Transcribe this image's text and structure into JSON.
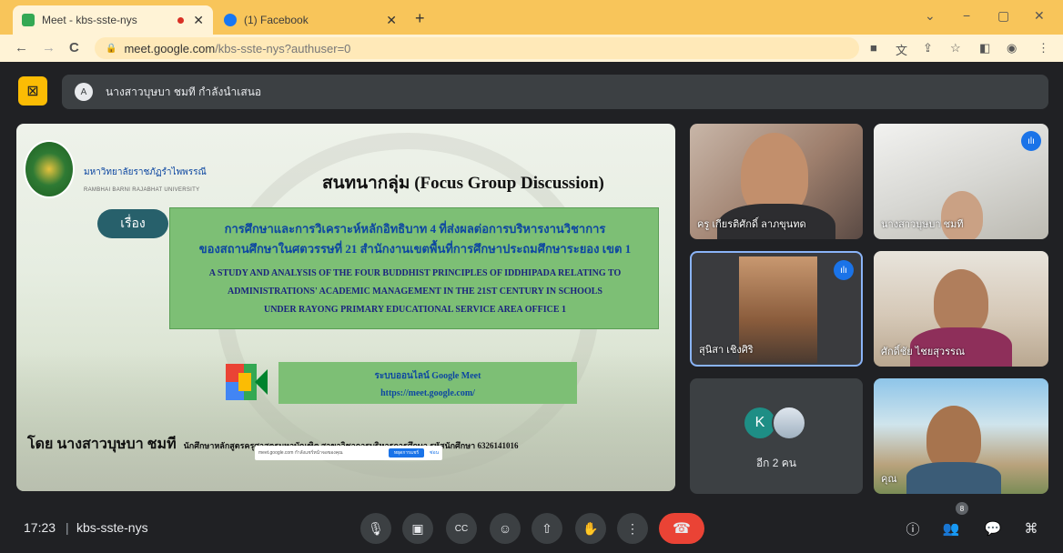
{
  "browser": {
    "tabs": [
      {
        "title": "Meet - kbs-sste-nys",
        "active": true
      },
      {
        "title": "(1) Facebook",
        "active": false
      }
    ],
    "new_tab": "+",
    "window": {
      "minimize": "−",
      "restore": "▢",
      "close": "✕",
      "chevron": "⌄"
    },
    "url": {
      "host": "meet.google.com",
      "path": "/kbs-sste-nys?authuser=0"
    },
    "nav": {
      "back": "←",
      "forward": "→",
      "reload": "C"
    }
  },
  "meet": {
    "presenting_text": "นางสาวบุษบา ชมที กำลังนำเสนอ",
    "presenter_initial": "A",
    "meeting_time": "17:23",
    "separator": "|",
    "meeting_code": "kbs-sste-nys",
    "participants_badge": "8",
    "others_label": "อีก 2 คน",
    "others_initial": "K"
  },
  "slide": {
    "university_th": "มหาวิทยาลัยราชภัฏรำไพพรรณี",
    "university_en": "RAMBHAI BARNI RAJABHAT UNIVERSITY",
    "title": "สนทนากลุ่ม (Focus Group Discussion)",
    "subject_label": "เรื่อง",
    "thai_line1": "การศึกษาและการวิเคราะห์หลักอิทธิบาท 4 ที่ส่งผลต่อการบริหารงานวิชาการ",
    "thai_line2": "ของสถานศึกษาในศตวรรษที่ 21 สำนักงานเขตพื้นที่การศึกษาประถมศึกษาระยอง เขต 1",
    "en_line1": "A STUDY AND ANALYSIS OF THE FOUR BUDDHIST PRINCIPLES OF IDDHIPADA RELATING TO",
    "en_line2": "ADMINISTRATIONS' ACADEMIC MANAGEMENT IN THE 21ST CENTURY IN SCHOOLS",
    "en_line3": "UNDER RAYONG PRIMARY EDUCATIONAL SERVICE AREA OFFICE 1",
    "online_label": "ระบบออนไลน์ Google Meet",
    "online_url": "https://meet.google.com/",
    "by_line": "โดย นางสาวบุษบา ชมที",
    "by_details": "นักศึกษาหลักสูตรครุศาสตรมหาบัณฑิต   สาขาวิชาการบริหารการศึกษา   รหัสนักศึกษา 6326141016",
    "share_banner_text": "meet.google.com กำลังแชร์หน้าจอของคุณ",
    "share_stop": "หยุดการแชร์",
    "share_hide": "ซ่อน"
  },
  "tiles": [
    {
      "name": "ครู เกียรติศักดิ์ ลาภขุนทด",
      "speaking": false
    },
    {
      "name": "นางสาวบุษบา ชมที",
      "speaking": true
    },
    {
      "name": "สุนิสา เชิงศิริ",
      "speaking": true
    },
    {
      "name": "ศักดิ์ชัย ไชยสุวรรณ",
      "speaking": false
    },
    {
      "name": "คุณ",
      "speaking": false
    }
  ],
  "controls": {
    "mic": "🎙",
    "camera": "▣",
    "captions": "CC",
    "emoji": "☺",
    "present": "⇧",
    "hand": "✋",
    "more": "⋮",
    "end": "☎",
    "info": "ⓘ",
    "people": "👥",
    "chat": "💬",
    "activities": "⌘"
  },
  "colors": {
    "tabbar": "#f8c55a",
    "accent": "#fbbc04",
    "end_call": "#ea4335",
    "speaking": "#1a73e8"
  }
}
